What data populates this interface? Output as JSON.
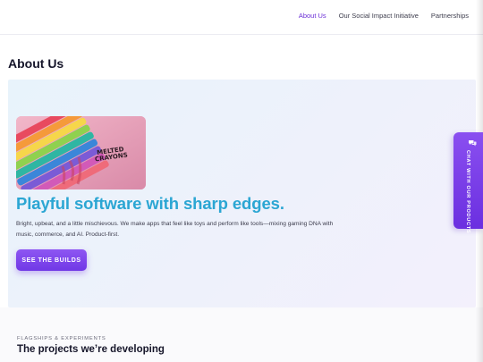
{
  "nav": {
    "items": [
      {
        "label": "About Us",
        "active": true
      },
      {
        "label": "Our Social Impact Initiative",
        "active": false
      },
      {
        "label": "Partnerships",
        "active": false
      }
    ]
  },
  "page": {
    "title": "About Us"
  },
  "hero": {
    "image_icon": "melted-crayons-image",
    "image_text": "MELTED CRAYONS",
    "headline": "Playful software with sharp edges.",
    "description": "Bright, upbeat, and a little mischievous. We make apps that feel like toys and perform like tools—mixing gaming DNA with music, commerce, and AI. Product-first.",
    "cta_label": "SEE THE BUILDS"
  },
  "flagships": {
    "eyebrow": "FLAGSHIPS & EXPERIMENTS",
    "title": "The projects we’re developing"
  },
  "chat_widget": {
    "label": "CHAT WITH OUR PRODUCTS",
    "icon": "chat-bubbles-icon"
  },
  "colors": {
    "accent": "#6b2fd6",
    "headline": "#2ba6d3",
    "cta": "#7a42ea"
  }
}
